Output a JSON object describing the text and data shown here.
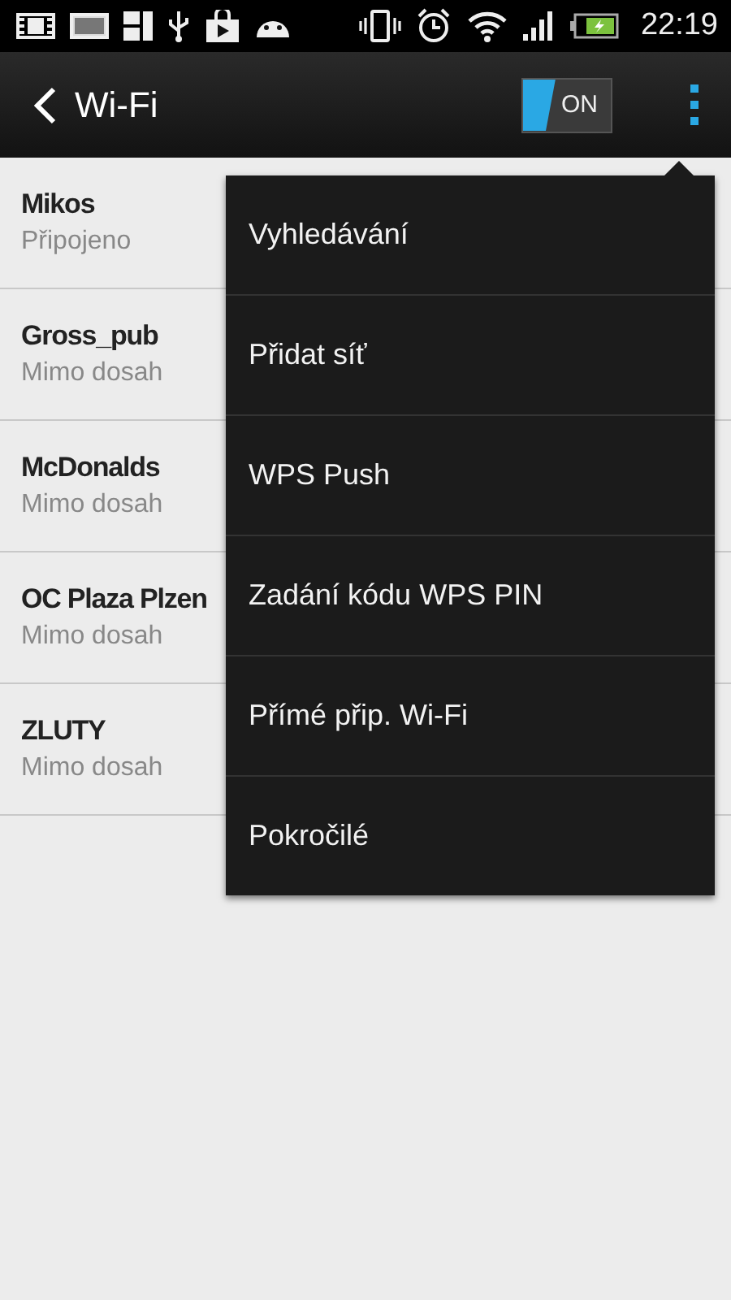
{
  "status_bar": {
    "time": "22:19"
  },
  "action_bar": {
    "title": "Wi-Fi",
    "toggle": {
      "label": "ON",
      "on": true
    }
  },
  "networks": [
    {
      "name": "Mikos",
      "status": "Připojeno"
    },
    {
      "name": "Gross_pub",
      "status": "Mimo dosah"
    },
    {
      "name": "McDonalds",
      "status": "Mimo dosah"
    },
    {
      "name": "OC Plaza Plzen",
      "status": "Mimo dosah"
    },
    {
      "name": "ZLUTY",
      "status": "Mimo dosah"
    }
  ],
  "menu": {
    "items": [
      "Vyhledávání",
      "Přidat síť",
      "WPS Push",
      "Zadání kódu WPS PIN",
      "Přímé přip. Wi-Fi",
      "Pokročilé"
    ]
  }
}
